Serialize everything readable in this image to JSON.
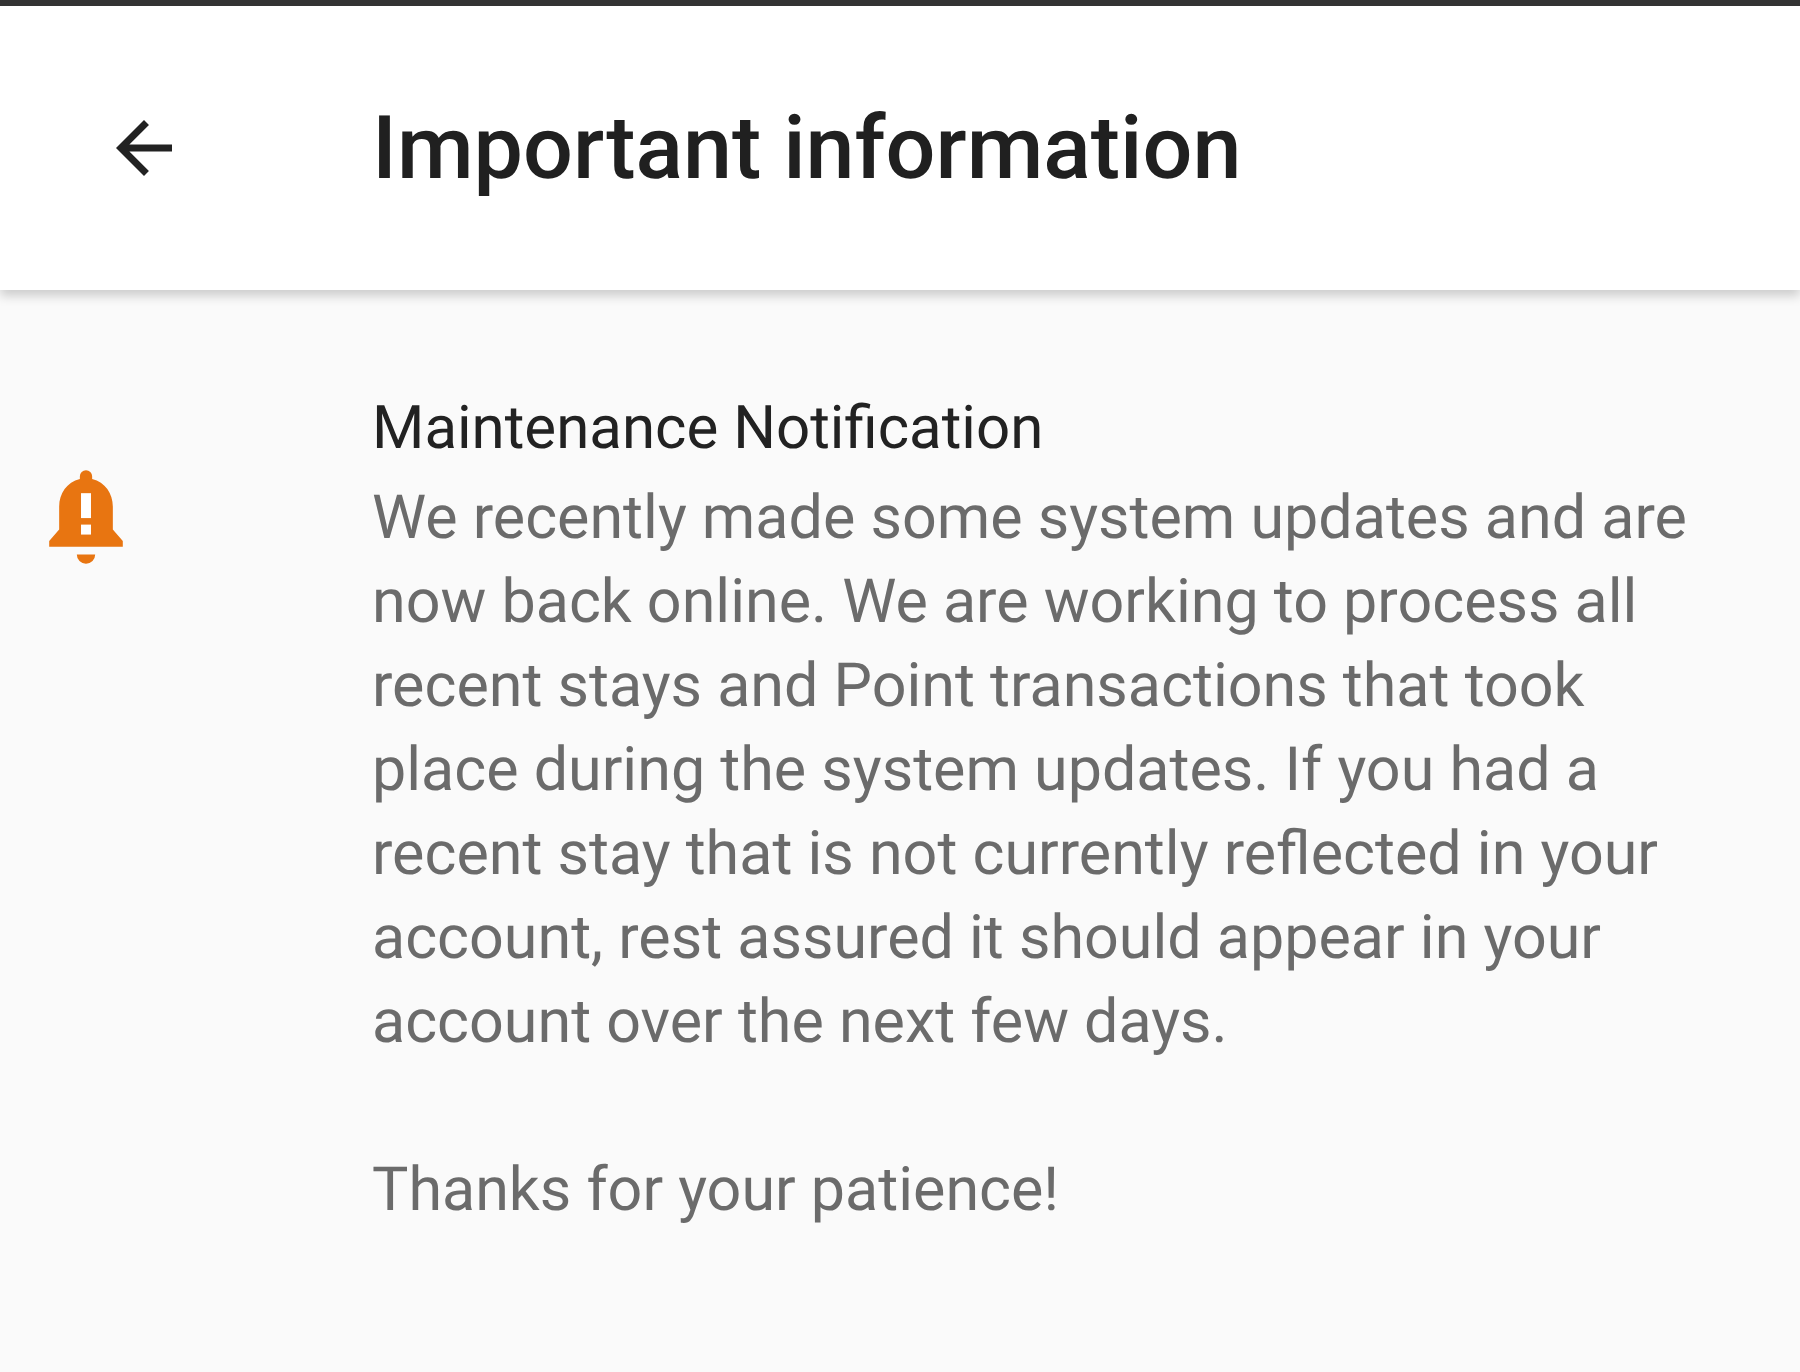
{
  "app_bar": {
    "title": "Important information"
  },
  "notice": {
    "title": "Maintenance Notification",
    "paragraphs": [
      "We recently made some system updates and are now back online. We are working to process all recent stays and Point transactions that took place during the system updates. If you had a recent stay that is not currently reflected in your account, rest assured it should appear in your account over the next few days.",
      "Thanks for your patience!"
    ]
  }
}
